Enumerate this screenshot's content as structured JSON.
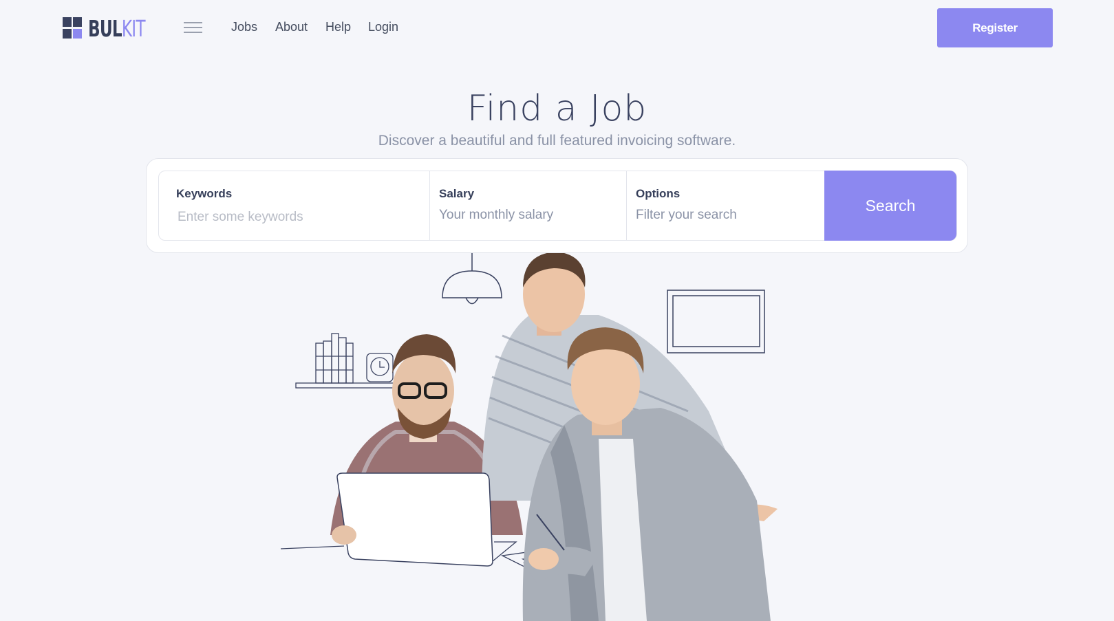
{
  "brand": {
    "name_part1": "BUL",
    "name_part2": "KIT",
    "accent_color": "#8c88f0",
    "dark_color": "#3a4260"
  },
  "nav": {
    "menu_icon": "hamburger-icon",
    "links": [
      {
        "label": "Jobs"
      },
      {
        "label": "About"
      },
      {
        "label": "Help"
      },
      {
        "label": "Login"
      }
    ],
    "register_label": "Register"
  },
  "hero": {
    "title": "Find a Job",
    "subtitle": "Discover a beautiful and full featured invoicing software."
  },
  "search": {
    "keywords": {
      "label": "Keywords",
      "placeholder": "Enter some keywords"
    },
    "salary": {
      "label": "Salary",
      "placeholder": "Your monthly salary"
    },
    "options": {
      "label": "Options",
      "placeholder": "Filter your search"
    },
    "button_label": "Search"
  },
  "illustration": {
    "icons": [
      "pendant-lamp-icon",
      "bookshelf-icon",
      "clock-icon",
      "picture-frame-icon",
      "laptop-icon"
    ]
  }
}
